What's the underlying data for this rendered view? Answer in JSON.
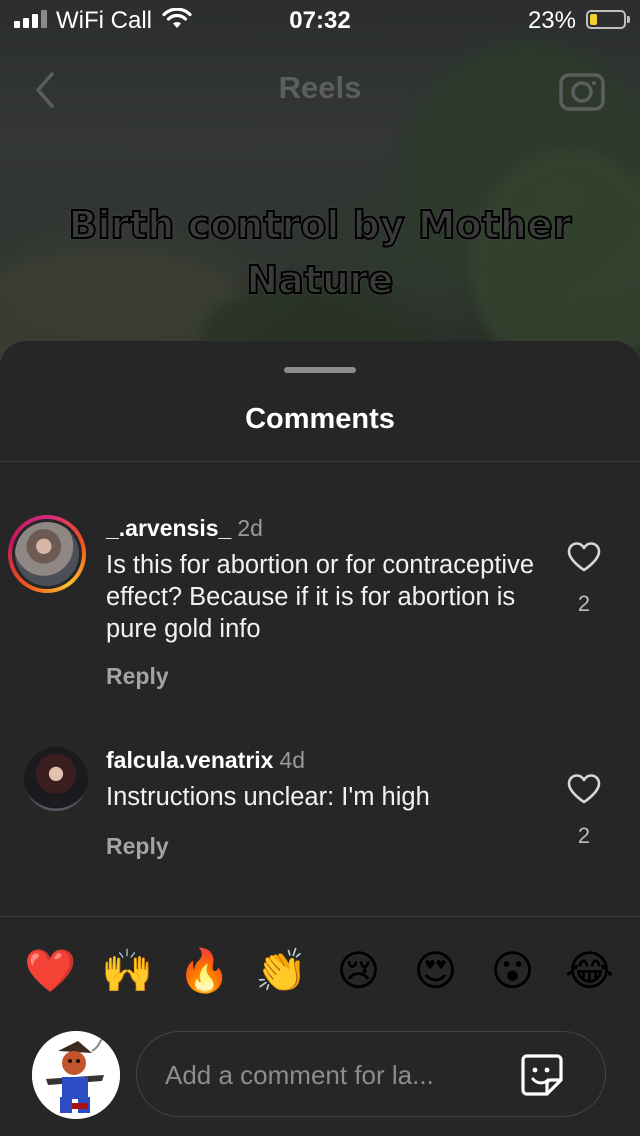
{
  "status_bar": {
    "carrier": "WiFi Call",
    "time": "07:32",
    "battery_percent": "23%",
    "battery_level": 0.23,
    "battery_color": "#f5d130"
  },
  "reel": {
    "title": "Reels",
    "caption": "Birth control by Mother Nature",
    "back_icon": "chevron-left-icon",
    "camera_icon": "camera-icon"
  },
  "comments_sheet": {
    "title": "Comments",
    "comments": [
      {
        "username": "_.arvensis_",
        "age": "2d",
        "text": "Is this for abortion or for contraceptive effect? Because if it is for abortion is pure gold info",
        "reply_label": "Reply",
        "likes": "2",
        "has_story_ring": true
      },
      {
        "username": "falcula.venatrix",
        "age": "4d",
        "text": "Instructions unclear: I'm high",
        "reply_label": "Reply",
        "likes": "2",
        "has_story_ring": false
      }
    ],
    "reactions": [
      "❤️",
      "🙌",
      "🔥",
      "👏",
      "😢",
      "😍",
      "😮",
      "😂"
    ],
    "input_placeholder": "Add a comment for la...",
    "sticker_icon": "sticker-icon"
  }
}
